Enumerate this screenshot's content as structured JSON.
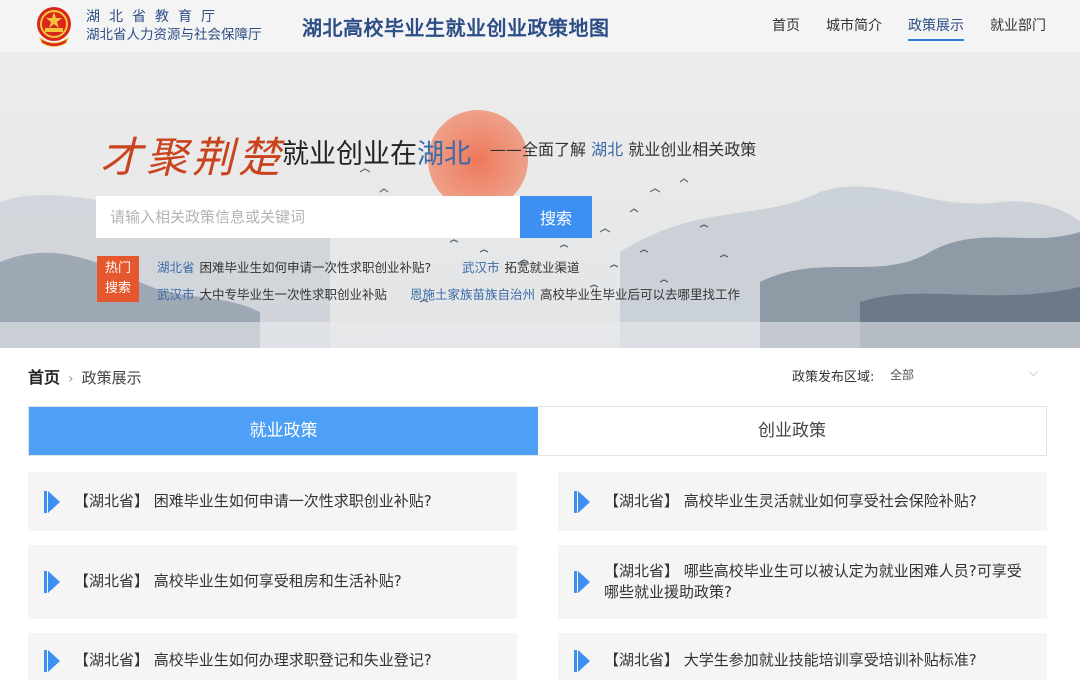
{
  "header": {
    "org_line1": "湖北省教育厅",
    "org_line2": "湖北省人力资源与社会保障厅",
    "site_title": "湖北高校毕业生就业创业政策地图",
    "nav": [
      {
        "label": "首页",
        "active": false
      },
      {
        "label": "城市简介",
        "active": false
      },
      {
        "label": "政策展示",
        "active": true
      },
      {
        "label": "就业部门",
        "active": false
      }
    ]
  },
  "banner": {
    "brush_slogan": "才聚荆楚",
    "main_prefix": "就业创业在",
    "main_highlight": "湖北",
    "sub_prefix": "——全面了解",
    "sub_highlight": "湖北",
    "sub_suffix": "就业创业相关政策",
    "search_placeholder": "请输入相关政策信息或关键词",
    "search_button": "搜索",
    "hot_badge_line1": "热门",
    "hot_badge_line2": "搜索",
    "hot_items": [
      {
        "loc": "湖北省",
        "text": "困难毕业生如何申请一次性求职创业补贴?"
      },
      {
        "loc": "武汉市",
        "text": "拓宽就业渠道"
      },
      {
        "loc": "武汉市",
        "text": "大中专毕业生一次性求职创业补贴"
      },
      {
        "loc": "恩施土家族苗族自治州",
        "text": "高校毕业生毕业后可以去哪里找工作"
      }
    ]
  },
  "breadcrumb": {
    "home": "首页",
    "sep": "›",
    "current": "政策展示"
  },
  "region": {
    "label": "政策发布区域:",
    "value": "全部"
  },
  "tabs": [
    {
      "label": "就业政策",
      "active": true
    },
    {
      "label": "创业政策",
      "active": false
    }
  ],
  "policies": [
    "【湖北省】 困难毕业生如何申请一次性求职创业补贴?",
    "【湖北省】 高校毕业生灵活就业如何享受社会保险补贴?",
    "【湖北省】 高校毕业生如何享受租房和生活补贴?",
    "【湖北省】 哪些高校毕业生可以被认定为就业困难人员?可享受哪些就业援助政策?",
    "【湖北省】 高校毕业生如何办理求职登记和失业登记?",
    "【湖北省】 大学生参加就业技能培训享受培训补贴标准?"
  ],
  "colors": {
    "accent": "#4da0f5",
    "brand": "#2d4e86",
    "hot": "#e5572c",
    "link": "#3b6aa8"
  }
}
